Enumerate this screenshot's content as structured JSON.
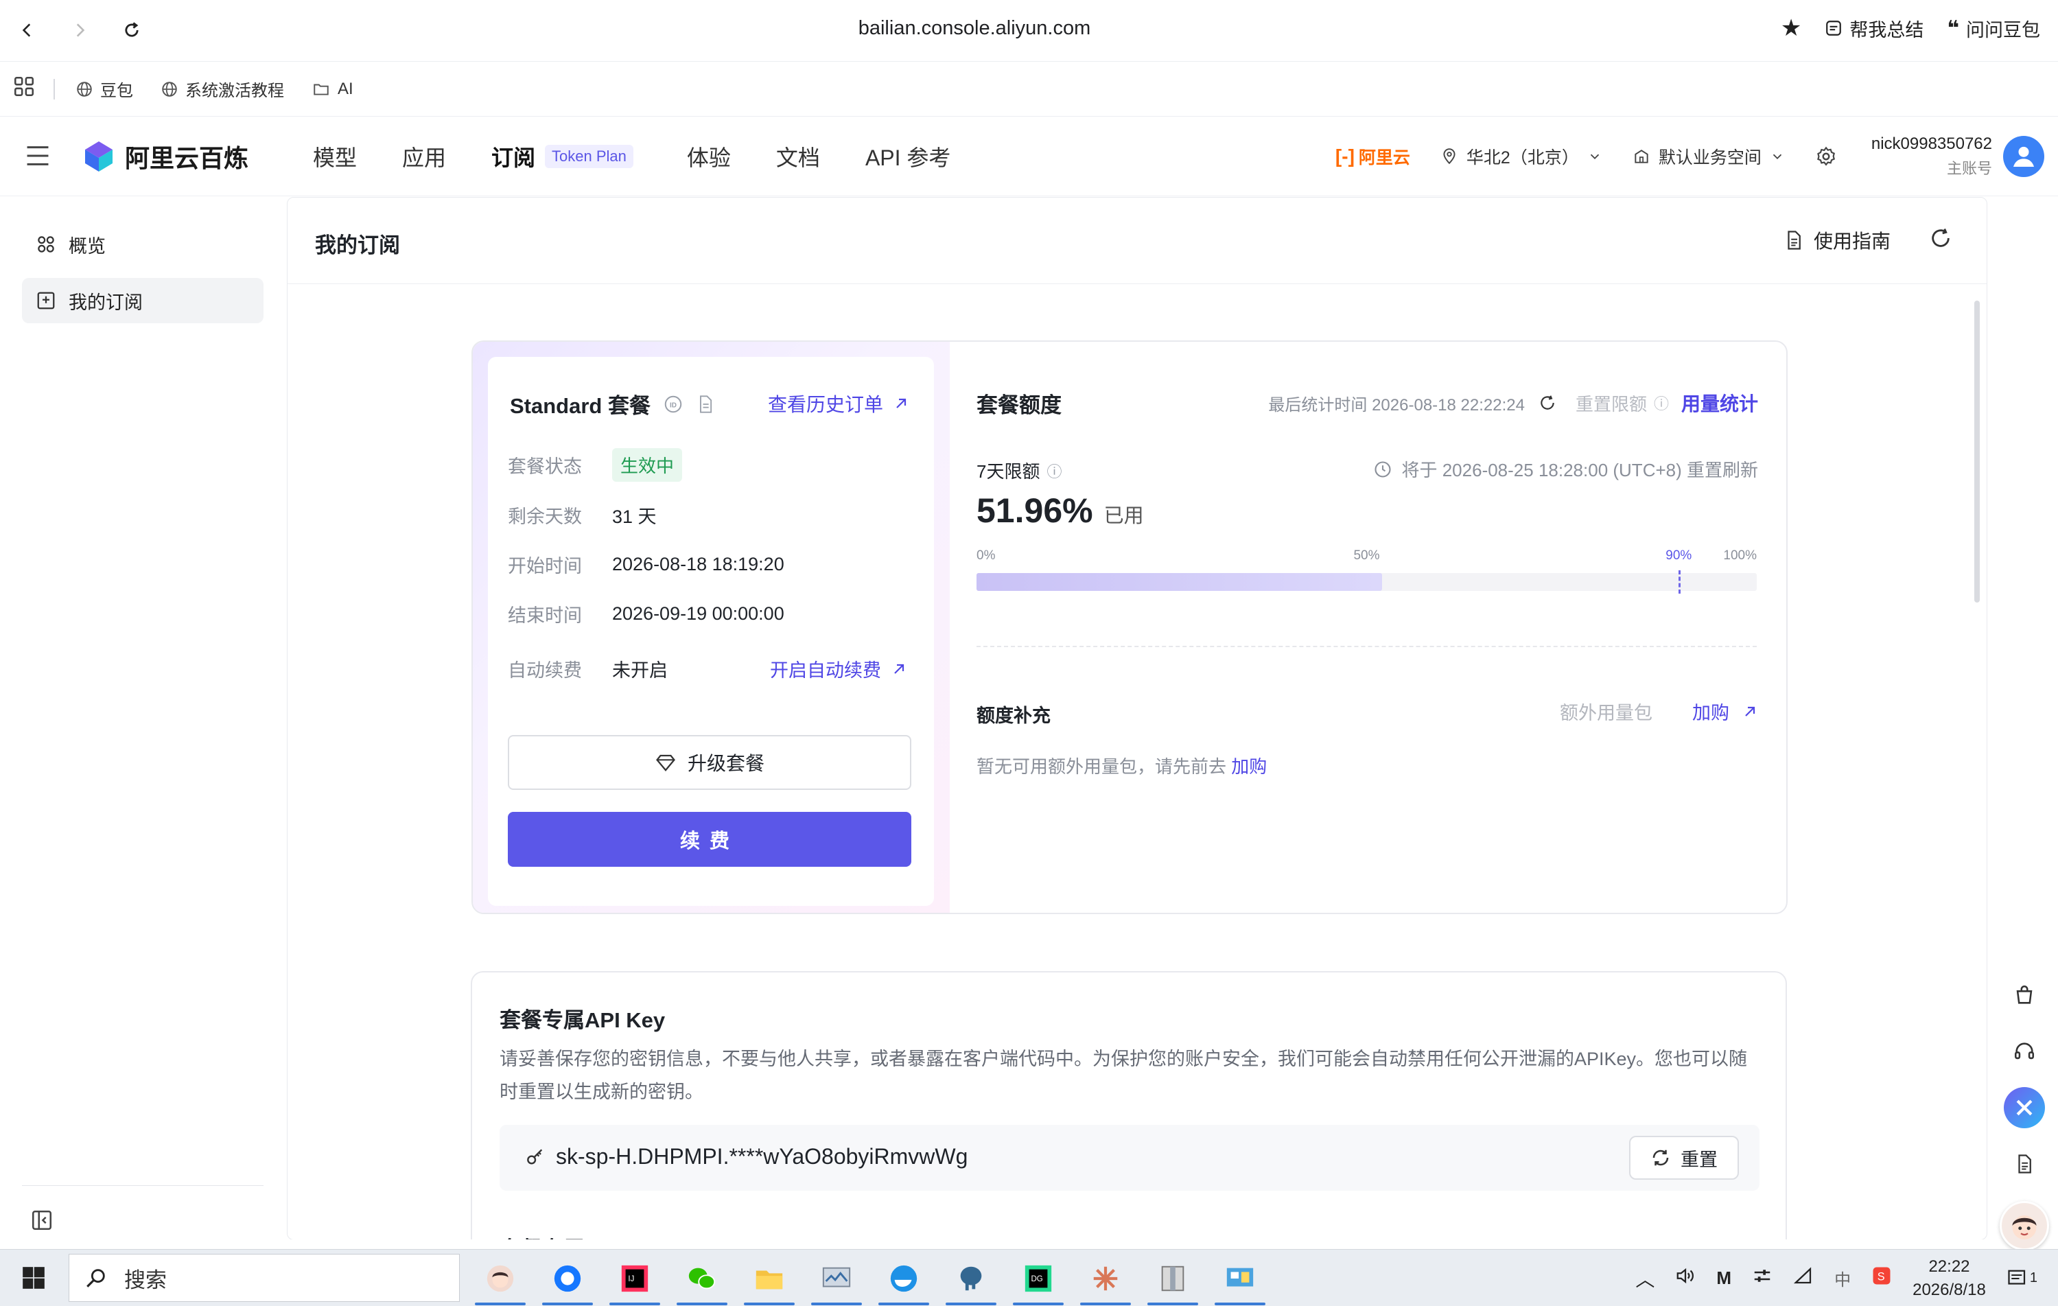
{
  "browser": {
    "url": "bailian.console.aliyun.com",
    "summarize_label": "帮我总结",
    "ask_label": "问问豆包"
  },
  "bookmarks": [
    {
      "label": "豆包"
    },
    {
      "label": "系统激活教程"
    },
    {
      "label": "AI"
    }
  ],
  "header": {
    "brand": "阿里云百炼",
    "nav": [
      {
        "label": "模型"
      },
      {
        "label": "应用"
      },
      {
        "label": "订阅",
        "badge": "Token Plan"
      },
      {
        "label": "体验"
      },
      {
        "label": "文档"
      },
      {
        "label": "API 参考"
      }
    ],
    "aliyun_label": "阿里云",
    "region": "华北2（北京）",
    "workspace": "默认业务空间",
    "username": "nick0998350762",
    "account_role": "主账号"
  },
  "sidebar": {
    "items": [
      {
        "label": "概览"
      },
      {
        "label": "我的订阅"
      }
    ]
  },
  "page": {
    "title": "我的订阅",
    "guide_label": "使用指南"
  },
  "plan": {
    "title": "Standard 套餐",
    "history_link": "查看历史订单",
    "rows": {
      "status_k": "套餐状态",
      "status_v": "生效中",
      "days_k": "剩余天数",
      "days_v": "31 天",
      "start_k": "开始时间",
      "start_v": "2026-08-18 18:19:20",
      "end_k": "结束时间",
      "end_v": "2026-09-19 00:00:00",
      "auto_k": "自动续费",
      "auto_v": "未开启"
    },
    "auto_link": "开启自动续费",
    "upgrade_label": "升级套餐",
    "renew_label": "续费"
  },
  "quota": {
    "title": "套餐额度",
    "last_stat": "最后统计时间 2026-08-18 22:22:24",
    "reset_limit": "重置限额",
    "usage_link": "用量统计",
    "window_label": "7天限额",
    "reset_info": "将于 2026-08-25 18:28:00 (UTC+8) 重置刷新",
    "percent": "51.96%",
    "used_suffix": "已用",
    "bar_value": 51.96,
    "bar_marker": 90,
    "ticks": [
      "0%",
      "50%",
      "90%",
      "100%"
    ],
    "supp_title": "额度补充",
    "extra_pack": "额外用量包",
    "buy_label": "加购",
    "empty_text": "暂无可用额外用量包，请先前去",
    "empty_link": "加购"
  },
  "apikey": {
    "title": "套餐专属API Key",
    "desc": "请妥善保存您的密钥信息，不要与他人共享，或者暴露在客户端代码中。为保护您的账户安全，我们可能会自动禁用任何公开泄漏的APIKey。您也可以随时重置以生成新的密钥。",
    "value": "sk-sp-H.DHPMPI.****wYaO8obyiRmvwWg",
    "reset_label": "重置",
    "next_section": "套餐专属Base URL"
  },
  "taskbar": {
    "search_label": "搜索",
    "time": "22:22",
    "date": "2026/8/18",
    "ime": "中",
    "notifications": "1"
  },
  "colors": {
    "accent": "#5b57e8",
    "link": "#4f46e5",
    "success": "#1e9b51",
    "aliyun_orange": "#ff6a00"
  }
}
